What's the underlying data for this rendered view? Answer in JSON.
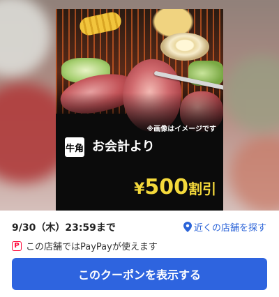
{
  "coupon": {
    "image_note": "※画像はイメージです",
    "logo_text": "牛角",
    "headline": "お会計より",
    "discount_yen": "¥",
    "discount_amount": "500",
    "discount_suffix": "割引"
  },
  "info": {
    "expiry": "9/30（木）23:59まで",
    "nearby_link": "近くの店舗を探す",
    "paypay_icon": "P",
    "paypay_text": "この店舗ではPayPayが使えます"
  },
  "cta": {
    "label": "このクーポンを表示する",
    "color": "#2e64df"
  },
  "colors": {
    "link": "#2b64d8",
    "discount": "#f4d93b",
    "paypay": "#ff0033"
  }
}
